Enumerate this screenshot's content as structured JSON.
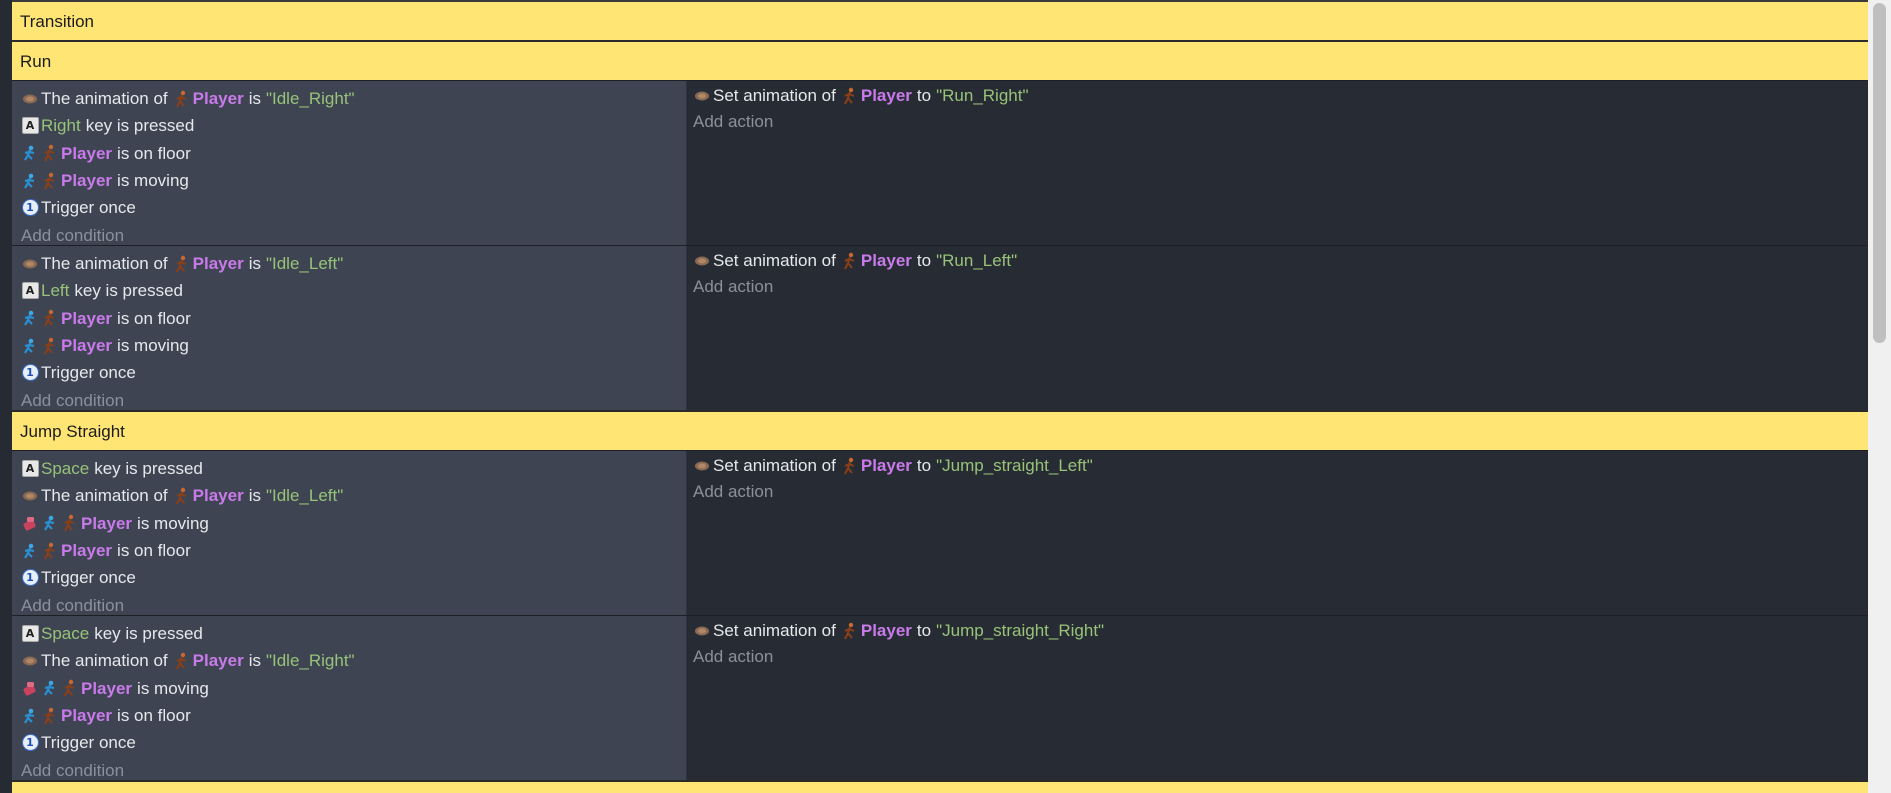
{
  "groups": [
    {
      "title": "Transition"
    },
    {
      "title": "Run"
    },
    {
      "title": "Jump Straight"
    }
  ],
  "labels": {
    "add_condition": "Add condition",
    "add_action": "Add action",
    "the_animation_of": "The animation of",
    "is": "is",
    "set_animation_of": "Set animation of",
    "to": "to",
    "key_is_pressed": "key is pressed",
    "is_on_floor": "is on floor",
    "is_moving": "is moving",
    "trigger_once": "Trigger once",
    "player": "Player"
  },
  "events": [
    {
      "conditions": {
        "anim": "\"Idle_Right\"",
        "key": "Right"
      },
      "action": {
        "anim": "\"Run_Right\""
      }
    },
    {
      "conditions": {
        "anim": "\"Idle_Left\"",
        "key": "Left"
      },
      "action": {
        "anim": "\"Run_Left\""
      }
    },
    {
      "conditions": {
        "anim": "\"Idle_Left\"",
        "key": "Space"
      },
      "action": {
        "anim": "\"Jump_straight_Left\""
      }
    },
    {
      "conditions": {
        "anim": "\"Idle_Right\"",
        "key": "Space"
      },
      "action": {
        "anim": "\"Jump_straight_Right\""
      }
    }
  ],
  "icons": {
    "animation": "animation-icon",
    "keyboard": "keyboard-icon",
    "platformer": "platformer-behavior-icon",
    "player": "player-sprite-icon",
    "trigger_once": "trigger-once-icon",
    "invert": "inverted-condition-icon"
  },
  "colors": {
    "comment_bg": "#ffe574",
    "condition_bg": "#3e4452",
    "action_bg": "#272b33",
    "object_name": "#c97aea",
    "string_value": "#98c379"
  }
}
